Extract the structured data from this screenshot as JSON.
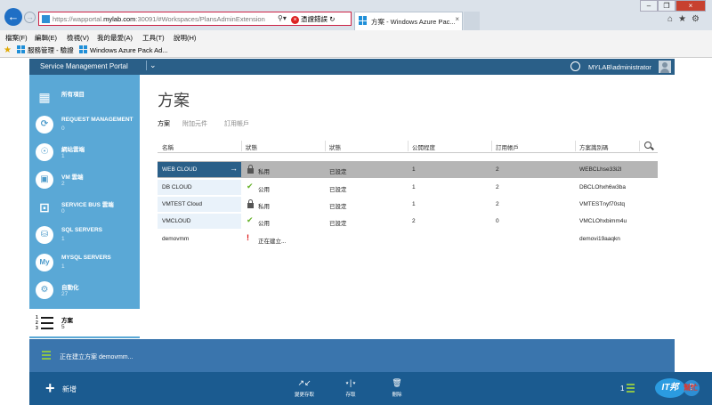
{
  "browser": {
    "url_prefix": "https://wapportal.",
    "url_domain": "mylab.com",
    "url_rest": ":30091/#Workspaces/PlansAdminExtension",
    "cert_error": "憑證錯誤",
    "tab_title": "方案 - Windows Azure Pac...",
    "menu": [
      "檔案(F)",
      "編輯(E)",
      "檢視(V)",
      "我的最愛(A)",
      "工具(T)",
      "說明(H)"
    ],
    "favorites": [
      "服務管理 - 驗證",
      "Windows Azure Pack Ad..."
    ]
  },
  "portal": {
    "title": "Service Management Portal",
    "user": "MYLAB\\administrator"
  },
  "sidebar": {
    "items": [
      {
        "label": "所有項目",
        "count": "",
        "icon": "grid-icon"
      },
      {
        "label": "REQUEST MANAGEMENT",
        "count": "0",
        "icon": "request-management-icon"
      },
      {
        "label": "網站雲端",
        "count": "1",
        "icon": "web-sites-icon"
      },
      {
        "label": "VM 雲端",
        "count": "2",
        "icon": "vm-clouds-icon"
      },
      {
        "label": "SERVICE BUS 雲端",
        "count": "0",
        "icon": "service-bus-icon"
      },
      {
        "label": "SQL SERVERS",
        "count": "1",
        "icon": "sql-servers-icon"
      },
      {
        "label": "MYSQL SERVERS",
        "count": "1",
        "icon": "mysql-servers-icon"
      },
      {
        "label": "自動化",
        "count": "27",
        "icon": "automation-icon"
      },
      {
        "label": "方案",
        "count": "5",
        "icon": "plans-icon"
      }
    ]
  },
  "main": {
    "title": "方案",
    "tabs": [
      "方案",
      "附加元件",
      "訂用帳戶"
    ],
    "columns": [
      "名稱",
      "狀態",
      "狀態",
      "公開程度",
      "訂用帳戶",
      "方案識別碼"
    ],
    "rows": [
      {
        "name": "WEB CLOUD",
        "status": "私用",
        "state": "已設定",
        "public": "1",
        "subs": "2",
        "id": "WEBCLhse33i2l",
        "status_icon": "lock-icon"
      },
      {
        "name": "DB CLOUD",
        "status": "公用",
        "state": "已設定",
        "public": "1",
        "subs": "2",
        "id": "DBCLOhxh6w3ba",
        "status_icon": "check-icon"
      },
      {
        "name": "VMTEST Cloud",
        "status": "私用",
        "state": "已設定",
        "public": "1",
        "subs": "2",
        "id": "VMTESTnyf70stq",
        "status_icon": "lock-icon"
      },
      {
        "name": "VMCLOUD",
        "status": "公用",
        "state": "已設定",
        "public": "2",
        "subs": "0",
        "id": "VMCLOhxbimm4u",
        "status_icon": "check-icon"
      },
      {
        "name": "demovmm",
        "status": "正在建立...",
        "state": "",
        "public": "",
        "subs": "",
        "id": "demovi19aaqkn",
        "status_icon": "warning-icon"
      }
    ]
  },
  "notification": {
    "text": "正在建立方案 demovmm..."
  },
  "commands": {
    "new": "新增",
    "items": [
      "變更存取",
      "存取",
      "刪除"
    ],
    "count": "1"
  },
  "watermark": {
    "logo": "IT邦",
    "text": "幫忙"
  },
  "colors": {
    "header": "#2a5f88",
    "sidebar": "#5aa8d6",
    "notify": "#3a75ad",
    "cmdbar": "#1b5b90",
    "selected": "#b5b5b5",
    "check": "#66b22a"
  }
}
